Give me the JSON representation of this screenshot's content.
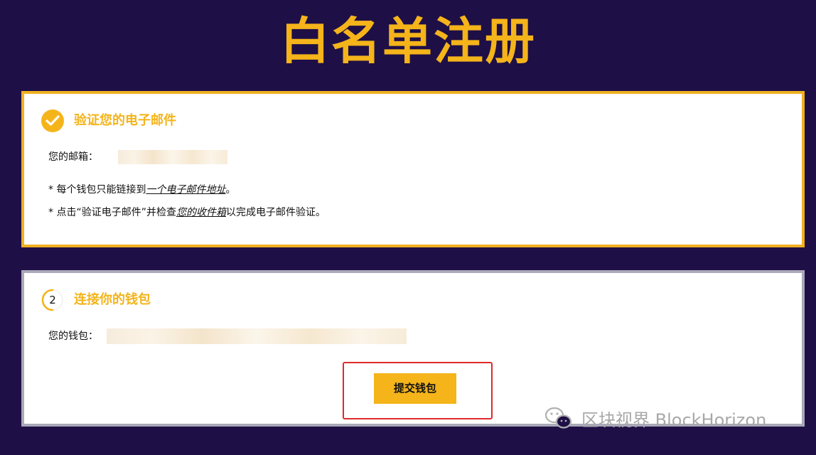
{
  "page": {
    "title": "白名单注册"
  },
  "step1": {
    "heading": "验证您的电子邮件",
    "email_label": "您的邮箱：",
    "note1_prefix": "* 每个钱包只能链接到",
    "note1_emph": "一个电子邮件地址",
    "note1_suffix": "。",
    "note2_prefix": "* 点击“验证电子邮件”并检查",
    "note2_emph": "您的收件箱",
    "note2_suffix": "以完成电子邮件验证。",
    "status_icon": "check-icon"
  },
  "step2": {
    "number": "2",
    "heading": "连接你的钱包",
    "wallet_label": "您的钱包：",
    "submit_label": "提交钱包"
  },
  "watermark": {
    "text": "区块视界 BlockHorizon",
    "icon": "wechat-icon"
  },
  "colors": {
    "background": "#1f0f47",
    "accent": "#f4b41a",
    "highlight_border": "#e02a2a",
    "inactive_border": "#a9a9b9"
  }
}
